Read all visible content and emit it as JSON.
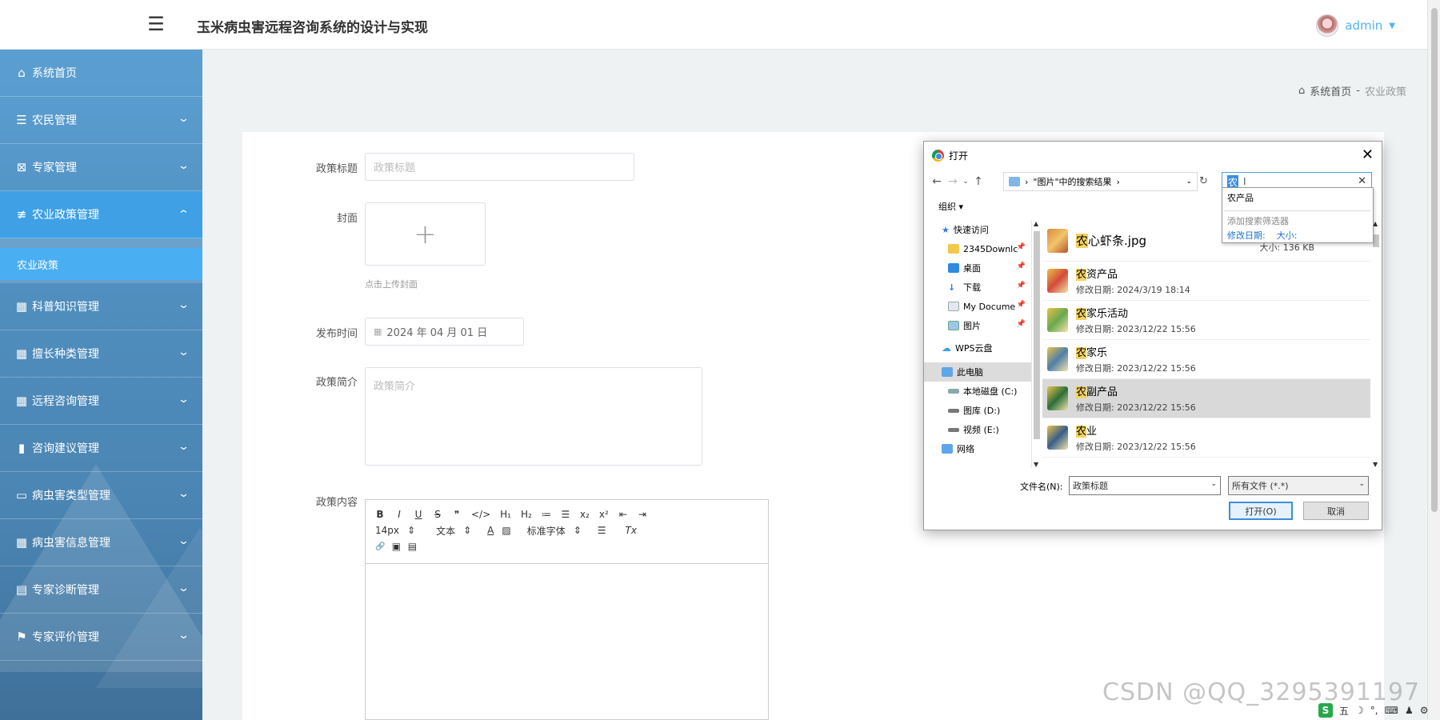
{
  "header": {
    "title": "玉米病虫害远程咨询系统的设计与实现",
    "user": "admin",
    "menu_icon": "hamburger-icon"
  },
  "sidebar": {
    "items": [
      {
        "label": "系统首页",
        "icon": "home-icon"
      },
      {
        "label": "农民管理",
        "icon": "list-icon"
      },
      {
        "label": "专家管理",
        "icon": "clipboard-x-icon"
      },
      {
        "label": "农业政策管理",
        "icon": "sliders-icon"
      },
      {
        "label": "科普知识管理",
        "icon": "grid-icon"
      },
      {
        "label": "擅长种类管理",
        "icon": "grid-icon"
      },
      {
        "label": "远程咨询管理",
        "icon": "grid-icon"
      },
      {
        "label": "咨询建议管理",
        "icon": "bar-chart-icon"
      },
      {
        "label": "病虫害类型管理",
        "icon": "monitor-icon"
      },
      {
        "label": "病虫害信息管理",
        "icon": "grid-icon"
      },
      {
        "label": "专家诊断管理",
        "icon": "clipboard-icon"
      },
      {
        "label": "专家评价管理",
        "icon": "flag-icon"
      }
    ],
    "sub_item": "农业政策"
  },
  "breadcrumb": {
    "home": "系统首页",
    "sep": "-",
    "current": "农业政策"
  },
  "form": {
    "title_label": "政策标题",
    "title_placeholder": "政策标题",
    "cover_label": "封面",
    "upload_plus": "+",
    "upload_hint": "点击上传封面",
    "date_label": "发布时间",
    "date_value": "2024 年 04 月 01 日",
    "summary_label": "政策简介",
    "summary_placeholder": "政策简介",
    "content_label": "政策内容"
  },
  "editor": {
    "row1": [
      "B",
      "I",
      "U",
      "S",
      "❞",
      "</>",
      "H₁",
      "H₂",
      "≔",
      "☰",
      "x₂",
      "x²",
      "⇤",
      "⇥"
    ],
    "font_size": "14px",
    "text_style": "文本",
    "font_family": "标准字体",
    "row3": [
      "🔗",
      "▣",
      "▤"
    ]
  },
  "dialog": {
    "title": "打开",
    "path": "\"图片\"中的搜索结果",
    "search_query": "农",
    "organize": "组织 ▾",
    "dropdown_suggestion": "农产品",
    "dropdown_hint": "添加搜索筛选器",
    "dropdown_filters": [
      "修改日期:",
      "大小:"
    ],
    "tree": [
      {
        "label": "快速访问",
        "pinned": false
      },
      {
        "label": "2345Downlc",
        "pinned": true
      },
      {
        "label": "桌面",
        "pinned": true
      },
      {
        "label": "下载",
        "pinned": true
      },
      {
        "label": "My Docume",
        "pinned": true
      },
      {
        "label": "图片",
        "pinned": true
      },
      {
        "label": "WPS云盘",
        "pinned": false
      },
      {
        "label": "此电脑",
        "pinned": false
      },
      {
        "label": "本地磁盘 (C:)",
        "pinned": false
      },
      {
        "label": "图库 (D:)",
        "pinned": false
      },
      {
        "label": "视频 (E:)",
        "pinned": false
      },
      {
        "label": "网络",
        "pinned": false
      }
    ],
    "files": [
      {
        "hl": "农",
        "rest": "心虾条.jpg",
        "meta": "",
        "size": "大小: 136 KB"
      },
      {
        "hl": "农",
        "rest": "资产品",
        "meta": "修改日期: 2024/3/19 18:14",
        "size": ""
      },
      {
        "hl": "农",
        "rest": "家乐活动",
        "meta": "修改日期: 2023/12/22 15:56",
        "size": ""
      },
      {
        "hl": "农",
        "rest": "家乐",
        "meta": "修改日期: 2023/12/22 15:56",
        "size": ""
      },
      {
        "hl": "农",
        "rest": "副产品",
        "meta": "修改日期: 2023/12/22 15:56",
        "size": ""
      },
      {
        "hl": "农",
        "rest": "业",
        "meta": "修改日期: 2023/12/22 15:56",
        "size": ""
      }
    ],
    "filename_label": "文件名(N):",
    "filename_value": "政策标题",
    "filetype": "所有文件 (*.*)",
    "open_btn": "打开(O)",
    "cancel_btn": "取消"
  },
  "watermark": "CSDN @QQ_3295391197",
  "tray": [
    "五",
    "☽",
    "°,",
    "⌨",
    "♟",
    "⚙"
  ],
  "colors": {
    "sidebar_active": "#3fa0e6",
    "sub_item": "#4aaef2",
    "accent": "#4fb3f5",
    "highlight": "#f4d35e"
  }
}
